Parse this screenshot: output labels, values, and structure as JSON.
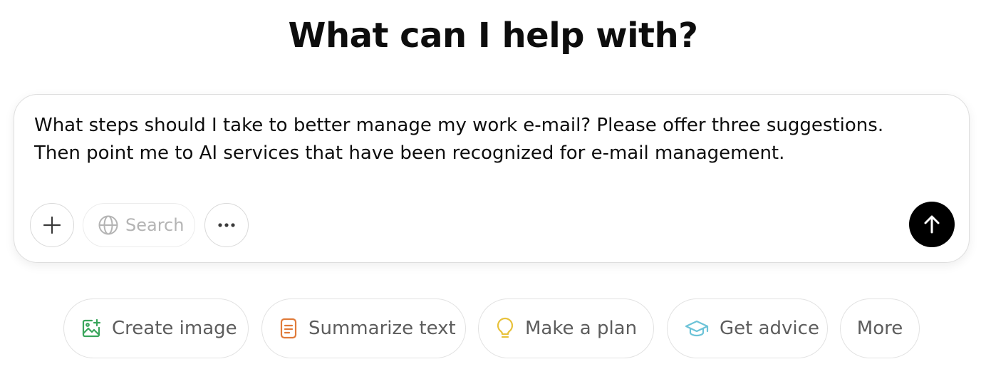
{
  "heading": "What can I help with?",
  "composer": {
    "prompt_text": "What steps should I take to better manage my work e-mail? Please offer three suggestions. Then point me to AI services that have been recognized for e-mail management.",
    "search_label": "Search",
    "icons": {
      "attach": "plus-icon",
      "search": "globe-icon",
      "tools": "ellipsis-icon",
      "send": "arrow-up-icon"
    }
  },
  "suggestions": [
    {
      "label": "Create image",
      "icon": "image-icon",
      "color": "#39a55b"
    },
    {
      "label": "Summarize text",
      "icon": "document-icon",
      "color": "#e07b3a"
    },
    {
      "label": "Make a plan",
      "icon": "lightbulb-icon",
      "color": "#e8c23d"
    },
    {
      "label": "Get advice",
      "icon": "graduation-cap-icon",
      "color": "#6cc3d8"
    },
    {
      "label": "More",
      "icon": "",
      "color": ""
    }
  ],
  "colors": {
    "send_button": "#000000",
    "chip_text": "#5d5d5d",
    "search_placeholder": "#b4b4b4"
  }
}
